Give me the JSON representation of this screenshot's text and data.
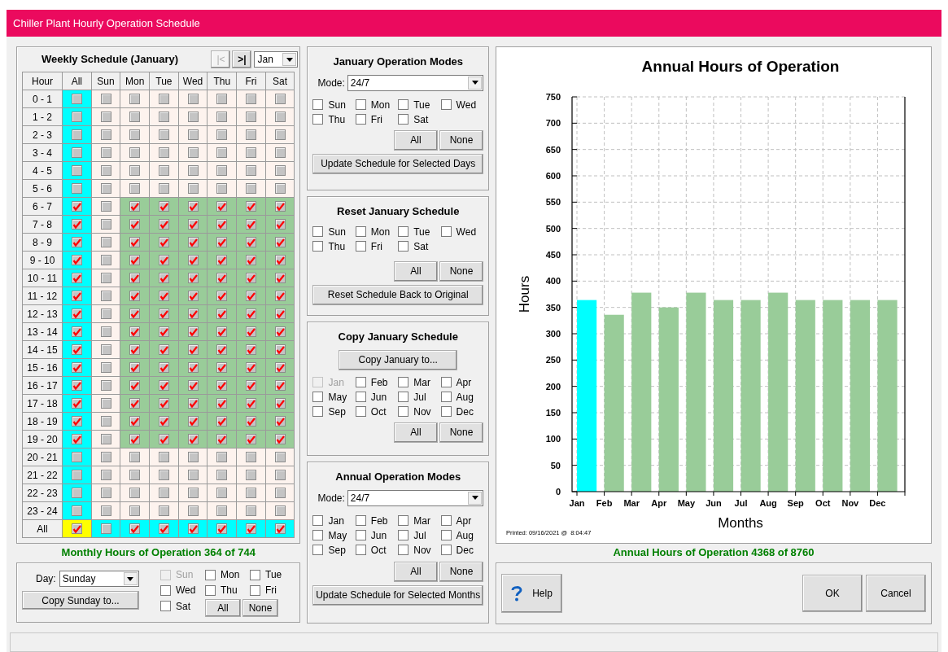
{
  "window": {
    "title": "Chiller Plant Hourly Operation Schedule"
  },
  "weekly_schedule": {
    "title": "Weekly Schedule (January)",
    "nav_buttons": [
      {
        "label": "|<",
        "disabled": true
      },
      {
        "label": ">|",
        "disabled": false
      }
    ],
    "month_select": {
      "value": "Jan"
    },
    "columns": [
      "Hour",
      "All",
      "Sun",
      "Mon",
      "Tue",
      "Wed",
      "Thu",
      "Fri",
      "Sat"
    ],
    "rows": [
      {
        "hour": "0 - 1",
        "cells": [
          {
            "checked": false
          },
          {
            "checked": false
          },
          {
            "checked": false
          },
          {
            "checked": false
          },
          {
            "checked": false
          },
          {
            "checked": false
          },
          {
            "checked": false
          },
          {
            "checked": false
          }
        ]
      },
      {
        "hour": "1 - 2",
        "cells": [
          {
            "checked": false
          },
          {
            "checked": false
          },
          {
            "checked": false
          },
          {
            "checked": false
          },
          {
            "checked": false
          },
          {
            "checked": false
          },
          {
            "checked": false
          },
          {
            "checked": false
          }
        ]
      },
      {
        "hour": "2 - 3",
        "cells": [
          {
            "checked": false
          },
          {
            "checked": false
          },
          {
            "checked": false
          },
          {
            "checked": false
          },
          {
            "checked": false
          },
          {
            "checked": false
          },
          {
            "checked": false
          },
          {
            "checked": false
          }
        ]
      },
      {
        "hour": "3 - 4",
        "cells": [
          {
            "checked": false
          },
          {
            "checked": false
          },
          {
            "checked": false
          },
          {
            "checked": false
          },
          {
            "checked": false
          },
          {
            "checked": false
          },
          {
            "checked": false
          },
          {
            "checked": false
          }
        ]
      },
      {
        "hour": "4 - 5",
        "cells": [
          {
            "checked": false
          },
          {
            "checked": false
          },
          {
            "checked": false
          },
          {
            "checked": false
          },
          {
            "checked": false
          },
          {
            "checked": false
          },
          {
            "checked": false
          },
          {
            "checked": false
          }
        ]
      },
      {
        "hour": "5 - 6",
        "cells": [
          {
            "checked": false
          },
          {
            "checked": false
          },
          {
            "checked": false
          },
          {
            "checked": false
          },
          {
            "checked": false
          },
          {
            "checked": false
          },
          {
            "checked": false
          },
          {
            "checked": false
          }
        ]
      },
      {
        "hour": "6 - 7",
        "cells": [
          {
            "checked": true
          },
          {
            "checked": false
          },
          {
            "checked": true
          },
          {
            "checked": true
          },
          {
            "checked": true
          },
          {
            "checked": true
          },
          {
            "checked": true
          },
          {
            "checked": true
          }
        ]
      },
      {
        "hour": "7 - 8",
        "cells": [
          {
            "checked": true
          },
          {
            "checked": false
          },
          {
            "checked": true
          },
          {
            "checked": true
          },
          {
            "checked": true
          },
          {
            "checked": true
          },
          {
            "checked": true
          },
          {
            "checked": true
          }
        ]
      },
      {
        "hour": "8 - 9",
        "cells": [
          {
            "checked": true
          },
          {
            "checked": false
          },
          {
            "checked": true
          },
          {
            "checked": true
          },
          {
            "checked": true
          },
          {
            "checked": true
          },
          {
            "checked": true
          },
          {
            "checked": true
          }
        ]
      },
      {
        "hour": "9 - 10",
        "cells": [
          {
            "checked": true
          },
          {
            "checked": false
          },
          {
            "checked": true
          },
          {
            "checked": true
          },
          {
            "checked": true
          },
          {
            "checked": true
          },
          {
            "checked": true
          },
          {
            "checked": true
          }
        ]
      },
      {
        "hour": "10 - 11",
        "cells": [
          {
            "checked": true
          },
          {
            "checked": false
          },
          {
            "checked": true
          },
          {
            "checked": true
          },
          {
            "checked": true
          },
          {
            "checked": true
          },
          {
            "checked": true
          },
          {
            "checked": true
          }
        ]
      },
      {
        "hour": "11 - 12",
        "cells": [
          {
            "checked": true
          },
          {
            "checked": false
          },
          {
            "checked": true
          },
          {
            "checked": true
          },
          {
            "checked": true
          },
          {
            "checked": true
          },
          {
            "checked": true
          },
          {
            "checked": true
          }
        ]
      },
      {
        "hour": "12 - 13",
        "cells": [
          {
            "checked": true
          },
          {
            "checked": false
          },
          {
            "checked": true
          },
          {
            "checked": true
          },
          {
            "checked": true
          },
          {
            "checked": true
          },
          {
            "checked": true
          },
          {
            "checked": true
          }
        ]
      },
      {
        "hour": "13 - 14",
        "cells": [
          {
            "checked": true
          },
          {
            "checked": false
          },
          {
            "checked": true
          },
          {
            "checked": true
          },
          {
            "checked": true
          },
          {
            "checked": true
          },
          {
            "checked": true
          },
          {
            "checked": true
          }
        ]
      },
      {
        "hour": "14 - 15",
        "cells": [
          {
            "checked": true
          },
          {
            "checked": false
          },
          {
            "checked": true
          },
          {
            "checked": true
          },
          {
            "checked": true
          },
          {
            "checked": true
          },
          {
            "checked": true
          },
          {
            "checked": true
          }
        ]
      },
      {
        "hour": "15 - 16",
        "cells": [
          {
            "checked": true
          },
          {
            "checked": false
          },
          {
            "checked": true
          },
          {
            "checked": true
          },
          {
            "checked": true
          },
          {
            "checked": true
          },
          {
            "checked": true
          },
          {
            "checked": true
          }
        ]
      },
      {
        "hour": "16 - 17",
        "cells": [
          {
            "checked": true
          },
          {
            "checked": false
          },
          {
            "checked": true
          },
          {
            "checked": true
          },
          {
            "checked": true
          },
          {
            "checked": true
          },
          {
            "checked": true
          },
          {
            "checked": true
          }
        ]
      },
      {
        "hour": "17 - 18",
        "cells": [
          {
            "checked": true
          },
          {
            "checked": false
          },
          {
            "checked": true
          },
          {
            "checked": true
          },
          {
            "checked": true
          },
          {
            "checked": true
          },
          {
            "checked": true
          },
          {
            "checked": true
          }
        ]
      },
      {
        "hour": "18 - 19",
        "cells": [
          {
            "checked": true
          },
          {
            "checked": false
          },
          {
            "checked": true
          },
          {
            "checked": true
          },
          {
            "checked": true
          },
          {
            "checked": true
          },
          {
            "checked": true
          },
          {
            "checked": true
          }
        ]
      },
      {
        "hour": "19 - 20",
        "cells": [
          {
            "checked": true
          },
          {
            "checked": false
          },
          {
            "checked": true
          },
          {
            "checked": true
          },
          {
            "checked": true
          },
          {
            "checked": true
          },
          {
            "checked": true
          },
          {
            "checked": true
          }
        ]
      },
      {
        "hour": "20 - 21",
        "cells": [
          {
            "checked": false
          },
          {
            "checked": false
          },
          {
            "checked": false
          },
          {
            "checked": false
          },
          {
            "checked": false
          },
          {
            "checked": false
          },
          {
            "checked": false
          },
          {
            "checked": false
          }
        ]
      },
      {
        "hour": "21 - 22",
        "cells": [
          {
            "checked": false
          },
          {
            "checked": false
          },
          {
            "checked": false
          },
          {
            "checked": false
          },
          {
            "checked": false
          },
          {
            "checked": false
          },
          {
            "checked": false
          },
          {
            "checked": false
          }
        ]
      },
      {
        "hour": "22 - 23",
        "cells": [
          {
            "checked": false
          },
          {
            "checked": false
          },
          {
            "checked": false
          },
          {
            "checked": false
          },
          {
            "checked": false
          },
          {
            "checked": false
          },
          {
            "checked": false
          },
          {
            "checked": false
          }
        ]
      },
      {
        "hour": "23 - 24",
        "cells": [
          {
            "checked": false
          },
          {
            "checked": false
          },
          {
            "checked": false
          },
          {
            "checked": false
          },
          {
            "checked": false
          },
          {
            "checked": false
          },
          {
            "checked": false
          },
          {
            "checked": false
          }
        ]
      }
    ],
    "total_row": {
      "label": "All",
      "cells": [
        {
          "checked": true
        },
        {
          "checked": false
        },
        {
          "checked": true
        },
        {
          "checked": true
        },
        {
          "checked": true
        },
        {
          "checked": true
        },
        {
          "checked": true
        },
        {
          "checked": true
        }
      ]
    }
  },
  "monthly_hours": "Monthly Hours of Operation 364 of 744",
  "copy_day": {
    "day_label": "Day:",
    "day_value": "Sunday",
    "copy_button": "Copy Sunday to...",
    "days": [
      {
        "label": "Sun",
        "checked": false,
        "disabled": true
      },
      {
        "label": "Mon",
        "checked": false,
        "disabled": false
      },
      {
        "label": "Tue",
        "checked": false,
        "disabled": false
      },
      {
        "label": "Wed",
        "checked": false,
        "disabled": false
      },
      {
        "label": "Thu",
        "checked": false,
        "disabled": false
      },
      {
        "label": "Fri",
        "checked": false,
        "disabled": false
      },
      {
        "label": "Sat",
        "checked": false,
        "disabled": false
      }
    ],
    "buttons": [
      "All",
      "None"
    ]
  },
  "january_modes": {
    "title": "January Operation Modes",
    "mode_label": "Mode:",
    "mode_value": "24/7",
    "days": [
      {
        "label": "Sun",
        "checked": false
      },
      {
        "label": "Mon",
        "checked": false
      },
      {
        "label": "Tue",
        "checked": false
      },
      {
        "label": "Wed",
        "checked": false
      },
      {
        "label": "Thu",
        "checked": false
      },
      {
        "label": "Fri",
        "checked": false
      },
      {
        "label": "Sat",
        "checked": false
      }
    ],
    "buttons": [
      "All",
      "None"
    ],
    "update_button": "Update Schedule for Selected Days"
  },
  "reset_schedule": {
    "title": "Reset January Schedule",
    "days": [
      {
        "label": "Sun",
        "checked": false
      },
      {
        "label": "Mon",
        "checked": false
      },
      {
        "label": "Tue",
        "checked": false
      },
      {
        "label": "Wed",
        "checked": false
      },
      {
        "label": "Thu",
        "checked": false
      },
      {
        "label": "Fri",
        "checked": false
      },
      {
        "label": "Sat",
        "checked": false
      }
    ],
    "buttons": [
      "All",
      "None"
    ],
    "reset_button": "Reset Schedule Back to Original"
  },
  "copy_month": {
    "title": "Copy January Schedule",
    "copy_button": "Copy January to...",
    "months": [
      {
        "label": "Jan",
        "checked": false,
        "disabled": true
      },
      {
        "label": "Feb",
        "checked": false,
        "disabled": false
      },
      {
        "label": "Mar",
        "checked": false,
        "disabled": false
      },
      {
        "label": "Apr",
        "checked": false,
        "disabled": false
      },
      {
        "label": "May",
        "checked": false,
        "disabled": false
      },
      {
        "label": "Jun",
        "checked": false,
        "disabled": false
      },
      {
        "label": "Jul",
        "checked": false,
        "disabled": false
      },
      {
        "label": "Aug",
        "checked": false,
        "disabled": false
      },
      {
        "label": "Sep",
        "checked": false,
        "disabled": false
      },
      {
        "label": "Oct",
        "checked": false,
        "disabled": false
      },
      {
        "label": "Nov",
        "checked": false,
        "disabled": false
      },
      {
        "label": "Dec",
        "checked": false,
        "disabled": false
      }
    ],
    "buttons": [
      "All",
      "None"
    ]
  },
  "annual_modes": {
    "title": "Annual Operation Modes",
    "mode_label": "Mode:",
    "mode_value": "24/7",
    "months": [
      {
        "label": "Jan",
        "checked": false
      },
      {
        "label": "Feb",
        "checked": false
      },
      {
        "label": "Mar",
        "checked": false
      },
      {
        "label": "Apr",
        "checked": false
      },
      {
        "label": "May",
        "checked": false
      },
      {
        "label": "Jun",
        "checked": false
      },
      {
        "label": "Jul",
        "checked": false
      },
      {
        "label": "Aug",
        "checked": false
      },
      {
        "label": "Sep",
        "checked": false
      },
      {
        "label": "Oct",
        "checked": false
      },
      {
        "label": "Nov",
        "checked": false
      },
      {
        "label": "Dec",
        "checked": false
      }
    ],
    "buttons": [
      "All",
      "None"
    ],
    "update_button": "Update Schedule for Selected Months"
  },
  "chart": {
    "chart_data": {
      "type": "bar",
      "title": "Annual Hours of Operation",
      "xlabel": "Months",
      "ylabel": "Hours",
      "categories": [
        "Jan",
        "Feb",
        "Mar",
        "Apr",
        "May",
        "Jun",
        "Jul",
        "Aug",
        "Sep",
        "Oct",
        "Nov",
        "Dec"
      ],
      "series": [
        {
          "color": "#00ffff",
          "values": [
            364,
            null,
            null,
            null,
            null,
            null,
            null,
            null,
            null,
            null,
            null,
            null
          ]
        },
        {
          "color": "#99cc99",
          "values": [
            null,
            336,
            378,
            350,
            378,
            364,
            364,
            378,
            364,
            364,
            364,
            364
          ]
        }
      ],
      "stacked": true,
      "grid": true,
      "ylim": [
        0,
        750
      ],
      "yticks": [
        0,
        50,
        100,
        150,
        200,
        250,
        300,
        350,
        400,
        450,
        500,
        550,
        600,
        650,
        700,
        750
      ]
    },
    "printed": "Printed: 09/16/2021 @  8:04:47"
  },
  "annual_hours": "Annual Hours of Operation 4368 of 8760",
  "footer_buttons": [
    {
      "label": "Help",
      "kind": "help"
    },
    {
      "label": "OK",
      "kind": "plain"
    },
    {
      "label": "Cancel",
      "kind": "plain"
    }
  ]
}
